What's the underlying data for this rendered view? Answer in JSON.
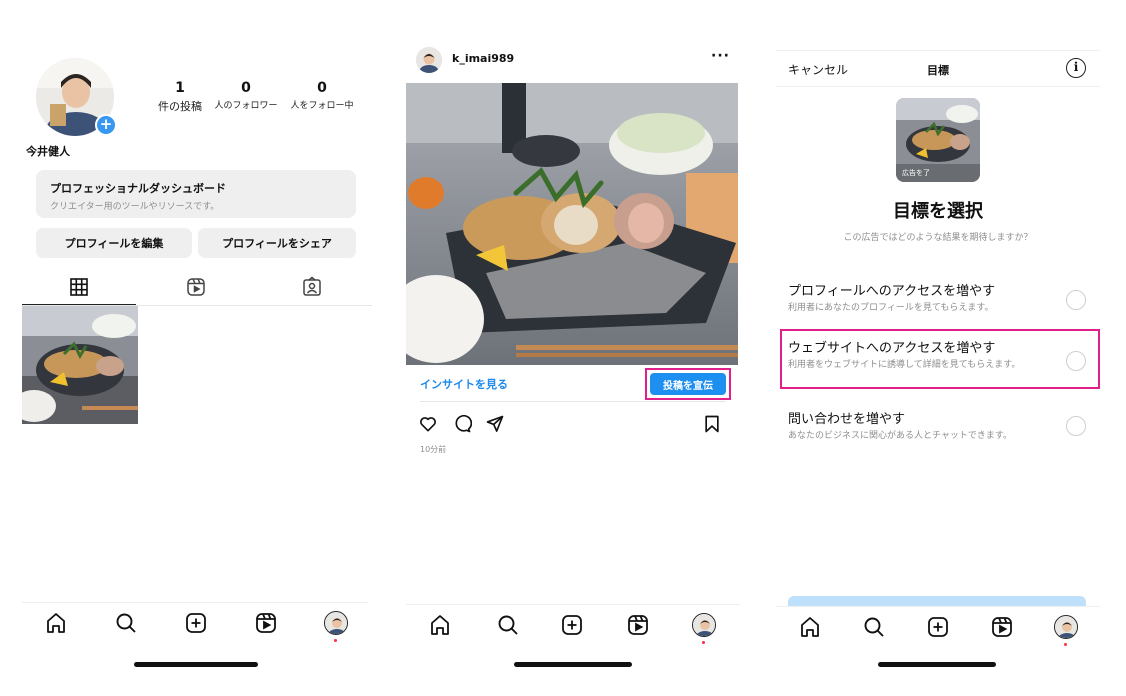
{
  "profile": {
    "name": "今井健人",
    "add_badge": "+",
    "stats": [
      {
        "value": "1",
        "label": "件の投稿"
      },
      {
        "value": "0",
        "label": "人のフォロワー"
      },
      {
        "value": "0",
        "label": "人をフォロー中"
      }
    ],
    "dashboard": {
      "title": "プロフェッショナルダッシュボード",
      "subtitle": "クリエイター用のツールやリソースです。"
    },
    "edit_button": "プロフィールを編集",
    "share_button": "プロフィールをシェア",
    "tabs": [
      "grid-icon",
      "reels-icon",
      "tagged-icon"
    ]
  },
  "post": {
    "username": "k_imai989",
    "more": "···",
    "insight_link": "インサイトを見る",
    "promote_button": "投稿を宣伝",
    "time": "10分前",
    "actions": [
      "heart-icon",
      "comment-icon",
      "share-icon",
      "bookmark-icon"
    ]
  },
  "goal": {
    "cancel": "キャンセル",
    "title": "目標",
    "info": "i",
    "thumb_tag": "広告を了",
    "heading": "目標を選択",
    "subheading": "この広告ではどのような結果を期待しますか？",
    "options": [
      {
        "title": "プロフィールへのアクセスを増やす",
        "desc": "利用者にあなたのプロフィールを見てもらえます。"
      },
      {
        "title": "ウェブサイトへのアクセスを増やす",
        "desc": "利用者をウェブサイトに誘導して詳細を見てもらえます。"
      },
      {
        "title": "問い合わせを増やす",
        "desc": "あなたのビジネスに関心がある人とチャットできます。"
      }
    ]
  },
  "nav": [
    "home-icon",
    "search-icon",
    "create-icon",
    "reels-icon",
    "profile-avatar"
  ],
  "colors": {
    "accent_blue": "#1d8ff0",
    "highlight_pink": "#e0208a",
    "link_blue": "#1c8aee",
    "button_gray": "#efefef"
  }
}
